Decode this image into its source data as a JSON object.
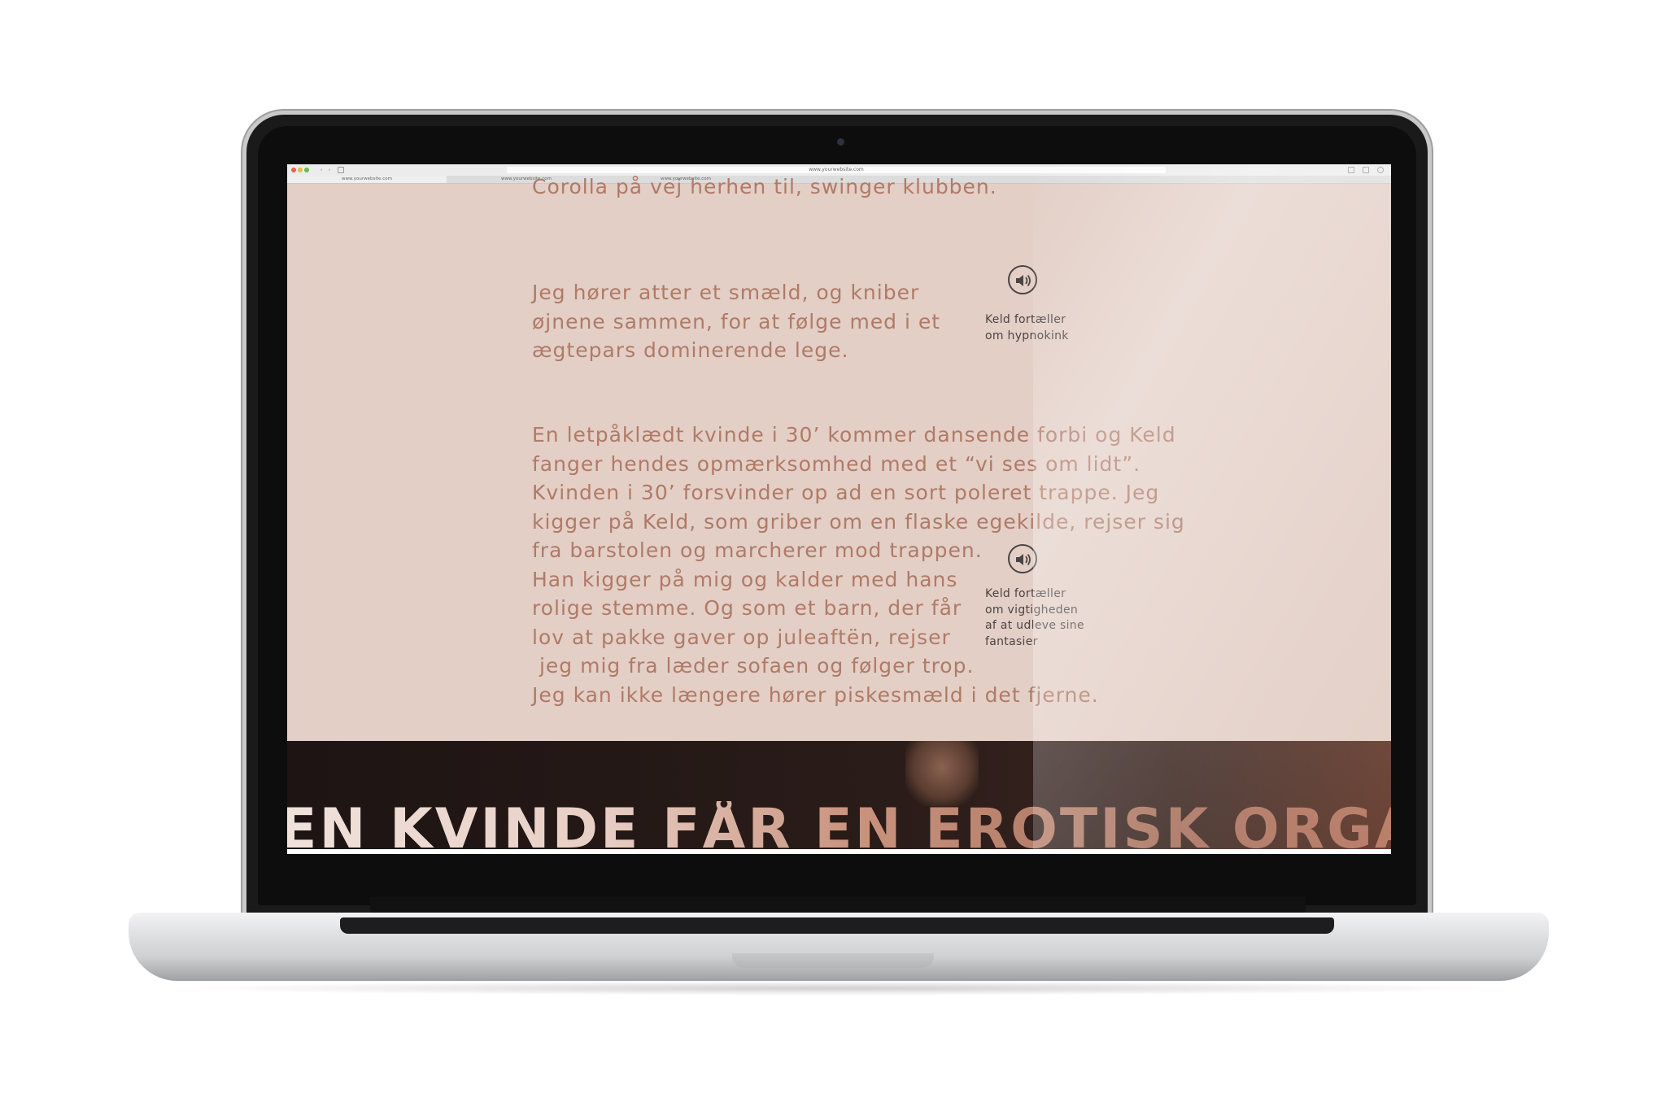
{
  "browser": {
    "address": "www.yourwebsite.com",
    "tabs": [
      "www.yourwebsite.com",
      "www.yourwebsite.com",
      "www.yourwebsite.com"
    ]
  },
  "article": {
    "paragraph_0": "Corolla på vej herhen til, swinger klubben.",
    "paragraph_1": "Jeg hører atter et smæld, og kniber\nøjnene sammen, for at følge med i et\nægtepars dominerende lege.",
    "paragraph_2": "En letpåklædt kvinde i 30’ kommer dansende forbi og Keld\nfanger hendes opmærksomhed med et “vi ses om lidt”.\nKvinden i 30’ forsvinder op ad en sort poleret trappe. Jeg\nkigger på Keld, som griber om en flaske egekilde, rejser sig\nfra barstolen og marcherer mod trappen.\nHan kigger på mig og kalder med hans\nrolige stemme. Og som et barn, der får\nlov at pakke gaver op juleaftën, rejser\n jeg mig fra læder sofaen og følger trop.\nJeg kan ikke længere hører piskesmæld i det fjerne."
  },
  "audio_clips": [
    {
      "label": "Keld fortæller\nom hypnokink",
      "icon": "speaker-icon"
    },
    {
      "label": "Keld fortæller\nom vigtigheden\naf at udleve sine\nfantasier",
      "icon": "speaker-icon"
    }
  ],
  "hero": {
    "headline": "EN KVINDE FÅR EN EROTISK ORGASME"
  },
  "colors": {
    "page_background": "#e3cfc6",
    "body_text": "#b07a67",
    "audio_text": "#4a4443",
    "hero_background": "#1d1413"
  }
}
